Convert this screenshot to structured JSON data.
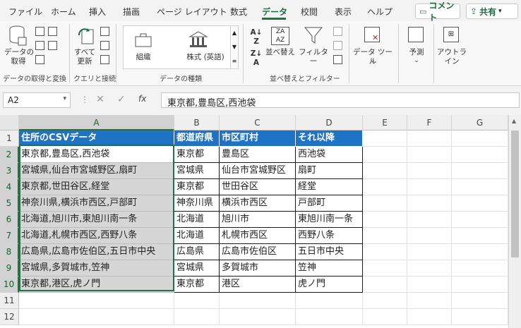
{
  "tabs": [
    "ファイル",
    "ホーム",
    "挿入",
    "描画",
    "ページ レイアウト",
    "数式",
    "データ",
    "校閲",
    "表示",
    "ヘルプ"
  ],
  "active_tab": "データ",
  "top_buttons": {
    "comment": "コメント",
    "share": "共有"
  },
  "ribbon": {
    "get_data_label": "データの\n取得",
    "refresh_label": "すべて\n更新",
    "data_types": [
      "組織",
      "株式 (英語)"
    ],
    "sort_label": "並べ替え",
    "filter_label": "フィルター",
    "data_tools_label": "データ ツール",
    "forecast_label": "予測",
    "outline_label": "アウトラ\nイン",
    "groups": [
      "データの取得と変換",
      "クエリと接続",
      "データの種類",
      "並べ替えとフィルター"
    ]
  },
  "formula_bar": {
    "name_box": "A2",
    "fx": "fx",
    "value": "東京都,豊島区,西池袋"
  },
  "columns": [
    "A",
    "B",
    "C",
    "D",
    "E",
    "F",
    "G"
  ],
  "rows": [
    "1",
    "2",
    "3",
    "4",
    "5",
    "6",
    "7",
    "8",
    "9",
    "10",
    "11",
    "12"
  ],
  "table": {
    "headers": [
      "住所のCSVデータ",
      "都道府県",
      "市区町村",
      "それ以降"
    ],
    "data": [
      [
        "東京都,豊島区,西池袋",
        "東京都",
        "豊島区",
        "西池袋"
      ],
      [
        "宮城県,仙台市宮城野区,扇町",
        "宮城県",
        "仙台市宮城野区",
        "扇町"
      ],
      [
        "東京都,世田谷区,経堂",
        "東京都",
        "世田谷区",
        "経堂"
      ],
      [
        "神奈川県,横浜市西区,戸部町",
        "神奈川県",
        "横浜市西区",
        "戸部町"
      ],
      [
        "北海道,旭川市,東旭川南一条",
        "北海道",
        "旭川市",
        "東旭川南一条"
      ],
      [
        "北海道,札幌市西区,西野八条",
        "北海道",
        "札幌市西区",
        "西野八条"
      ],
      [
        "広島県,広島市佐伯区,五日市中央",
        "広島県",
        "広島市佐伯区",
        "五日市中央"
      ],
      [
        "宮城県,多賀城市,笠神",
        "宮城県",
        "多賀城市",
        "笠神"
      ],
      [
        "東京都,港区,虎ノ門",
        "東京都",
        "港区",
        "虎ノ門"
      ]
    ]
  },
  "colors": {
    "accent": "#217346",
    "header_fill": "#1f73c4",
    "selection_fill": "#d6d6d6"
  }
}
